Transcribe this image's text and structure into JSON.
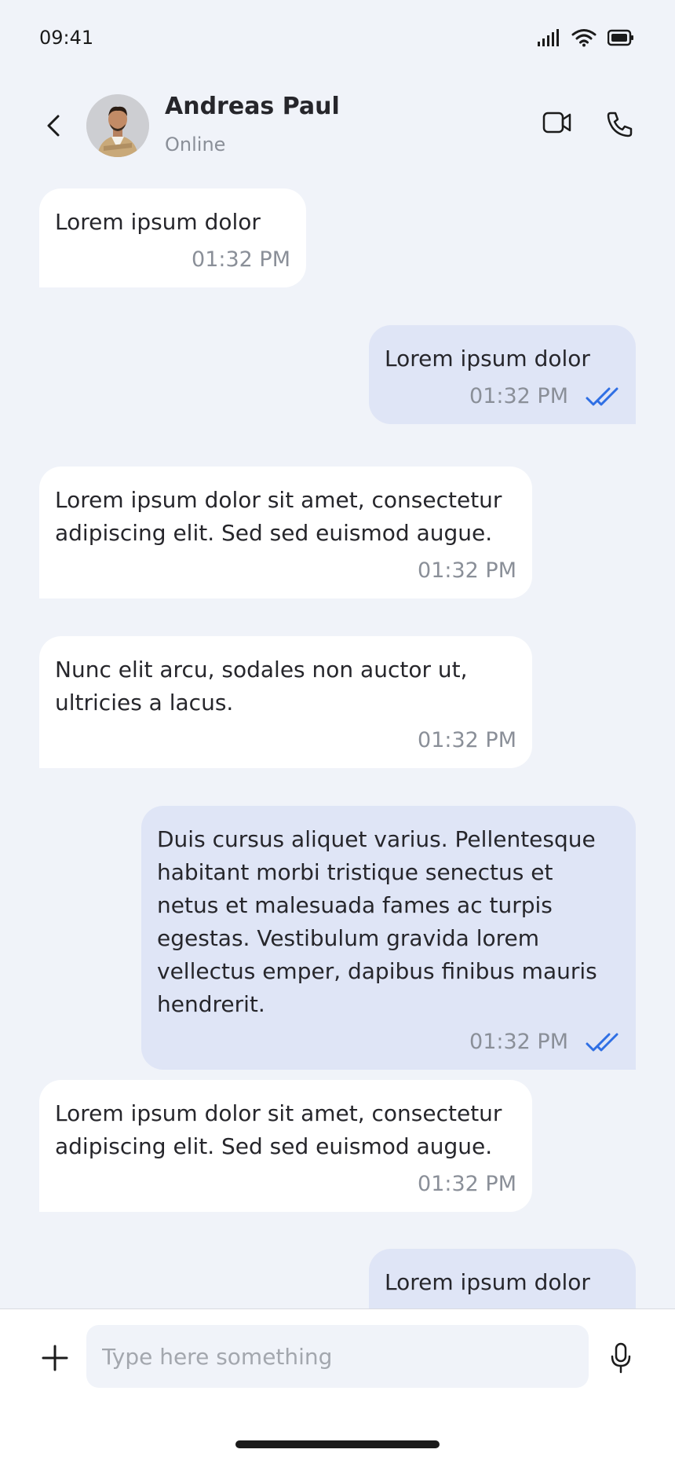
{
  "status_bar": {
    "time": "09:41"
  },
  "header": {
    "contact_name": "Andreas Paul",
    "contact_status": "Online"
  },
  "messages": [
    {
      "direction": "in",
      "text": "Lorem ipsum dolor",
      "time": "01:32 PM"
    },
    {
      "direction": "out",
      "text": "Lorem ipsum dolor",
      "time": "01:32 PM",
      "read": true
    },
    {
      "direction": "in",
      "text": "Lorem ipsum dolor sit amet, consectetur adipiscing elit. Sed sed euismod augue.",
      "time": "01:32 PM"
    },
    {
      "direction": "in",
      "text": "Nunc elit arcu, sodales non auctor ut, ultricies a lacus.",
      "time": "01:32 PM"
    },
    {
      "direction": "out",
      "text": "Duis cursus aliquet varius. Pellentesque habitant morbi tristique senectus et netus et malesuada fames ac turpis egestas. Vestibulum gravida lorem vellectus emper, dapibus finibus mauris hendrerit.",
      "time": "01:32 PM",
      "read": true
    },
    {
      "direction": "in",
      "text": "Lorem ipsum dolor sit amet, consectetur adipiscing elit. Sed sed euismod augue.",
      "time": "01:32 PM"
    },
    {
      "direction": "out",
      "text": "Lorem ipsum dolor"
    }
  ],
  "composer": {
    "placeholder": "Type here something"
  },
  "colors": {
    "background": "#f0f3f9",
    "incoming_bubble": "#ffffff",
    "outgoing_bubble": "#dfe5f6",
    "read_check": "#2f6fe4",
    "muted_text": "#8a8f98"
  },
  "icons": {
    "back": "chevron-left-icon",
    "video": "video-camera-icon",
    "call": "phone-icon",
    "attach": "plus-icon",
    "voice": "microphone-icon",
    "read_receipt": "double-check-icon"
  }
}
